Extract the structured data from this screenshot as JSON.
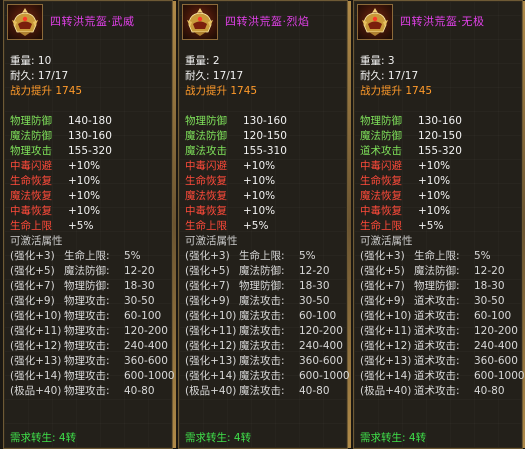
{
  "panels": [
    {
      "name": "四转洪荒盔·武威",
      "weight_label": "重量:",
      "weight": "10",
      "durability_label": "耐久:",
      "durability": "17/17",
      "power_label": "战力提升",
      "power": "1745",
      "attrs": [
        {
          "label": "物理防御",
          "value": "140-180",
          "color": "green"
        },
        {
          "label": "魔法防御",
          "value": "130-160",
          "color": "green"
        },
        {
          "label": "物理攻击",
          "value": "155-320",
          "color": "green"
        }
      ],
      "bonus": [
        {
          "label": "中毒闪避",
          "value": "+10%"
        },
        {
          "label": "生命恢复",
          "value": "+10%"
        },
        {
          "label": "魔法恢复",
          "value": "+10%"
        },
        {
          "label": "中毒恢复",
          "value": "+10%"
        },
        {
          "label": "生命上限",
          "value": "+5%"
        }
      ],
      "activatable_label": "可激活属性",
      "enhance": [
        {
          "lvl": "(强化+3)",
          "attr": "生命上限:",
          "val": "5%"
        },
        {
          "lvl": "(强化+5)",
          "attr": "魔法防御:",
          "val": "12-20"
        },
        {
          "lvl": "(强化+7)",
          "attr": "物理防御:",
          "val": "18-30"
        },
        {
          "lvl": "(强化+9)",
          "attr": "物理攻击:",
          "val": "30-50"
        },
        {
          "lvl": "(强化+10)",
          "attr": "物理攻击:",
          "val": "60-100"
        },
        {
          "lvl": "(强化+11)",
          "attr": "物理攻击:",
          "val": "120-200"
        },
        {
          "lvl": "(强化+12)",
          "attr": "物理攻击:",
          "val": "240-400"
        },
        {
          "lvl": "(强化+13)",
          "attr": "物理攻击:",
          "val": "360-600"
        },
        {
          "lvl": "(强化+14)",
          "attr": "物理攻击:",
          "val": "600-1000"
        },
        {
          "lvl": "(极品+40)",
          "attr": "物理攻击:",
          "val": "40-80"
        }
      ],
      "require_label": "需求转生:",
      "require": "4转"
    },
    {
      "name": "四转洪荒盔·烈焰",
      "weight_label": "重量:",
      "weight": "2",
      "durability_label": "耐久:",
      "durability": "17/17",
      "power_label": "战力提升",
      "power": "1745",
      "attrs": [
        {
          "label": "物理防御",
          "value": "130-160",
          "color": "green"
        },
        {
          "label": "魔法防御",
          "value": "120-150",
          "color": "green"
        },
        {
          "label": "魔法攻击",
          "value": "155-310",
          "color": "green"
        }
      ],
      "bonus": [
        {
          "label": "中毒闪避",
          "value": "+10%"
        },
        {
          "label": "生命恢复",
          "value": "+10%"
        },
        {
          "label": "魔法恢复",
          "value": "+10%"
        },
        {
          "label": "中毒恢复",
          "value": "+10%"
        },
        {
          "label": "生命上限",
          "value": "+5%"
        }
      ],
      "activatable_label": "可激活属性",
      "enhance": [
        {
          "lvl": "(强化+3)",
          "attr": "生命上限:",
          "val": "5%"
        },
        {
          "lvl": "(强化+5)",
          "attr": "魔法防御:",
          "val": "12-20"
        },
        {
          "lvl": "(强化+7)",
          "attr": "物理防御:",
          "val": "18-30"
        },
        {
          "lvl": "(强化+9)",
          "attr": "魔法攻击:",
          "val": "30-50"
        },
        {
          "lvl": "(强化+10)",
          "attr": "魔法攻击:",
          "val": "60-100"
        },
        {
          "lvl": "(强化+11)",
          "attr": "魔法攻击:",
          "val": "120-200"
        },
        {
          "lvl": "(强化+12)",
          "attr": "魔法攻击:",
          "val": "240-400"
        },
        {
          "lvl": "(强化+13)",
          "attr": "魔法攻击:",
          "val": "360-600"
        },
        {
          "lvl": "(强化+14)",
          "attr": "魔法攻击:",
          "val": "600-1000"
        },
        {
          "lvl": "(极品+40)",
          "attr": "魔法攻击:",
          "val": "40-80"
        }
      ],
      "require_label": "需求转生:",
      "require": "4转"
    },
    {
      "name": "四转洪荒盔·无极",
      "weight_label": "重量:",
      "weight": "3",
      "durability_label": "耐久:",
      "durability": "17/17",
      "power_label": "战力提升",
      "power": "1745",
      "attrs": [
        {
          "label": "物理防御",
          "value": "130-160",
          "color": "green"
        },
        {
          "label": "魔法防御",
          "value": "120-150",
          "color": "green"
        },
        {
          "label": "道术攻击",
          "value": "155-320",
          "color": "green"
        }
      ],
      "bonus": [
        {
          "label": "中毒闪避",
          "value": "+10%"
        },
        {
          "label": "生命恢复",
          "value": "+10%"
        },
        {
          "label": "魔法恢复",
          "value": "+10%"
        },
        {
          "label": "中毒恢复",
          "value": "+10%"
        },
        {
          "label": "生命上限",
          "value": "+5%"
        }
      ],
      "activatable_label": "可激活属性",
      "enhance": [
        {
          "lvl": "(强化+3)",
          "attr": "生命上限:",
          "val": "5%"
        },
        {
          "lvl": "(强化+5)",
          "attr": "魔法防御:",
          "val": "12-20"
        },
        {
          "lvl": "(强化+7)",
          "attr": "物理防御:",
          "val": "18-30"
        },
        {
          "lvl": "(强化+9)",
          "attr": "道术攻击:",
          "val": "30-50"
        },
        {
          "lvl": "(强化+10)",
          "attr": "道术攻击:",
          "val": "60-100"
        },
        {
          "lvl": "(强化+11)",
          "attr": "道术攻击:",
          "val": "120-200"
        },
        {
          "lvl": "(强化+12)",
          "attr": "道术攻击:",
          "val": "240-400"
        },
        {
          "lvl": "(强化+13)",
          "attr": "道术攻击:",
          "val": "360-600"
        },
        {
          "lvl": "(强化+14)",
          "attr": "道术攻击:",
          "val": "600-1000"
        },
        {
          "lvl": "(极品+40)",
          "attr": "道术攻击:",
          "val": "40-80"
        }
      ],
      "require_label": "需求转生:",
      "require": "4转"
    }
  ],
  "icon": "helmet-icon",
  "colors": {
    "name": "#e040e8",
    "orange": "#ff9a2a",
    "green": "#7ee05a",
    "red": "#ff4a3a",
    "require": "#3fe04a",
    "border": "#6e5a35"
  }
}
